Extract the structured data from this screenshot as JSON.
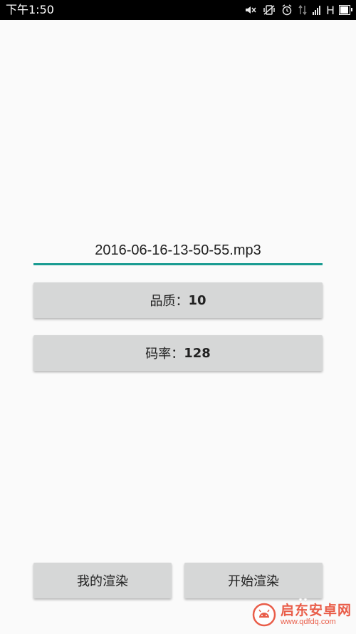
{
  "status_bar": {
    "time": "下午1:50",
    "network_type": "H",
    "icons": [
      "mute-icon",
      "vibrate-icon",
      "alarm-icon",
      "data-arrows-icon",
      "signal-icon",
      "battery-icon"
    ]
  },
  "file": {
    "name": "2016-06-16-13-50-55.mp3"
  },
  "settings": {
    "quality_label": "品质：",
    "quality_value": "10",
    "bitrate_label": "码率：",
    "bitrate_value": "128"
  },
  "actions": {
    "my_renders_label": "我的渲染",
    "start_render_label": "开始渲染"
  },
  "watermark": {
    "title": "启东安卓网",
    "url": "www.qdfdq.com"
  },
  "colors": {
    "accent": "#199b91",
    "button_bg": "#d6d7d7",
    "background": "#fafafa",
    "status_bar": "#000000",
    "watermark": "#e8503a"
  }
}
